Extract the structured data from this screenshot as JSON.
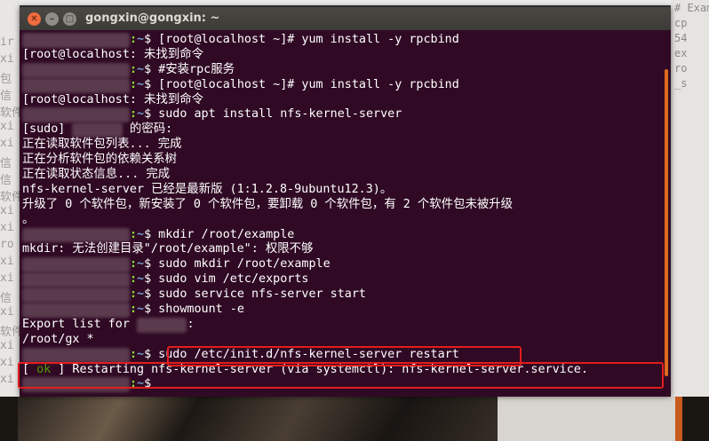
{
  "window": {
    "title": "gongxin@gongxin: ~",
    "close_glyph": "✕",
    "min_glyph": "–",
    "max_glyph": "□"
  },
  "prompt": {
    "path": "~",
    "dollar": "$"
  },
  "terminal": {
    "lines": [
      {
        "kind": "cmd",
        "text": " [root@localhost ~]# yum install -y rpcbind"
      },
      {
        "kind": "out",
        "text": "[root@localhost: 未找到命令"
      },
      {
        "kind": "cmd",
        "text": " #安装rpc服务"
      },
      {
        "kind": "cmd",
        "text": " [root@localhost ~]# yum install -y rpcbind"
      },
      {
        "kind": "out",
        "text": "[root@localhost: 未找到命令"
      },
      {
        "kind": "cmd",
        "text": " sudo apt install nfs-kernel-server"
      },
      {
        "kind": "out",
        "text": "[sudo] ",
        "suffix": " 的密码:"
      },
      {
        "kind": "out",
        "text": "正在读取软件包列表... 完成"
      },
      {
        "kind": "out",
        "text": "正在分析软件包的依赖关系树"
      },
      {
        "kind": "out",
        "text": "正在读取状态信息... 完成"
      },
      {
        "kind": "out",
        "text": "nfs-kernel-server 已经是最新版 (1:1.2.8-9ubuntu12.3)。"
      },
      {
        "kind": "out",
        "text": "升级了 0 个软件包，新安装了 0 个软件包，要卸载 0 个软件包，有 2 个软件包未被升级"
      },
      {
        "kind": "out",
        "text": "。"
      },
      {
        "kind": "cmd",
        "text": " mkdir /root/example"
      },
      {
        "kind": "out",
        "text": "mkdir: 无法创建目录\"/root/example\": 权限不够"
      },
      {
        "kind": "cmd",
        "text": " sudo mkdir /root/example"
      },
      {
        "kind": "cmd",
        "text": " sudo vim /etc/exports"
      },
      {
        "kind": "cmd",
        "text": " sudo service nfs-server start"
      },
      {
        "kind": "cmd",
        "text": " showmount -e"
      },
      {
        "kind": "out",
        "text": "Export list for ",
        "suffix": ":"
      },
      {
        "kind": "out",
        "text": "/root/gx *"
      },
      {
        "kind": "cmd",
        "text": " sudo /etc/init.d/nfs-kernel-server restart"
      },
      {
        "kind": "status",
        "text": "[ ",
        "ok": "ok",
        "suffix": " ] Restarting nfs-kernel-server (via systemctl): nfs-kernel-server.service."
      },
      {
        "kind": "cmd",
        "text": ""
      }
    ]
  },
  "background": {
    "right_fragments": [
      "# Example",
      "cp",
      "54",
      "ex",
      "ro",
      "_s"
    ],
    "left_fragments": [
      "ir",
      "xi",
      "包",
      "信",
      "软件",
      "xi",
      "xi",
      "信",
      "信",
      "软件",
      "xi",
      "xi",
      "ro",
      "xi",
      "xi",
      "信",
      "xi",
      "软件",
      "xi",
      "xi",
      "xi"
    ]
  },
  "colors": {
    "terminal_bg": "#300a24",
    "prompt_user": "#8ae234",
    "prompt_path": "#729fcf",
    "ok": "#4e9a06",
    "highlight_box": "#e31d1d"
  }
}
